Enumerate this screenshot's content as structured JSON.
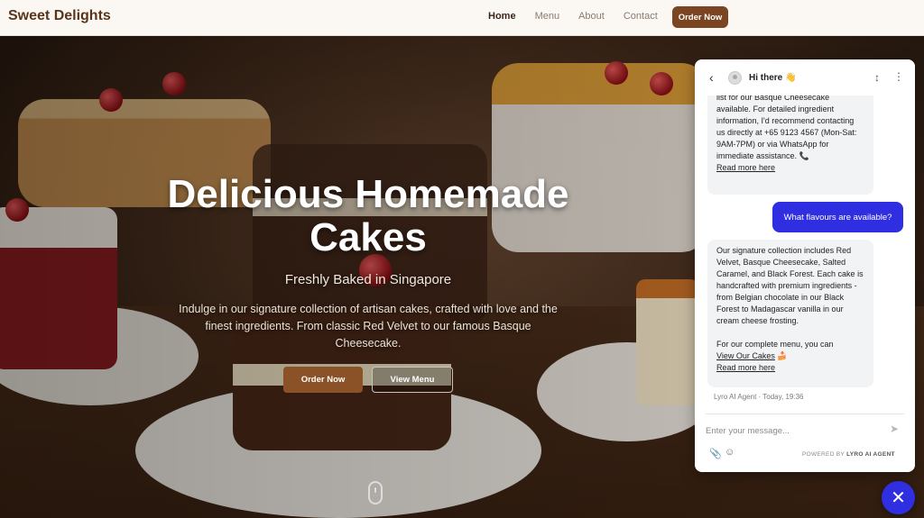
{
  "brand": "Sweet Delights",
  "nav": {
    "links": [
      "Home",
      "Menu",
      "About",
      "Contact"
    ],
    "order_button": "Order Now"
  },
  "hero": {
    "title": "Delicious Homemade Cakes",
    "subtitle": "Freshly Baked in Singapore",
    "description": "Indulge in our signature collection of artisan cakes, crafted with love and the finest ingredients. From classic Red Velvet to our famous Basque Cheesecake.",
    "order_button": "Order Now",
    "menu_button": "View Menu"
  },
  "chat": {
    "title": "Hi there 👋",
    "messages": [
      {
        "from": "agent",
        "text": "list for our Basque Cheesecake available. For detailed ingredient information, I'd recommend contacting us directly at +65 9123 4567 (Mon-Sat: 9AM-7PM) or via WhatsApp for immediate assistance. 📞",
        "link": "Read more here"
      },
      {
        "from": "user",
        "text": "What flavours are available?"
      },
      {
        "from": "agent",
        "text": "Our signature collection includes Red Velvet, Basque Cheesecake, Salted Caramel, and Black Forest. Each cake is handcrafted with premium ingredients - from Belgian chocolate in our Black Forest to Madagascar vanilla in our cream cheese frosting.",
        "text2": "For our complete menu, you can",
        "inline_link": "View Our Cakes",
        "inline_emoji": "🍰",
        "link": "Read more here"
      }
    ],
    "meta": "Lyro AI Agent · Today, 19:36",
    "input_placeholder": "Enter your message...",
    "powered_prefix": "POWERED BY",
    "powered_brand": "LYRO AI AGENT"
  },
  "colors": {
    "brand_brown": "#7a4520",
    "chat_accent": "#2f2ee0"
  }
}
